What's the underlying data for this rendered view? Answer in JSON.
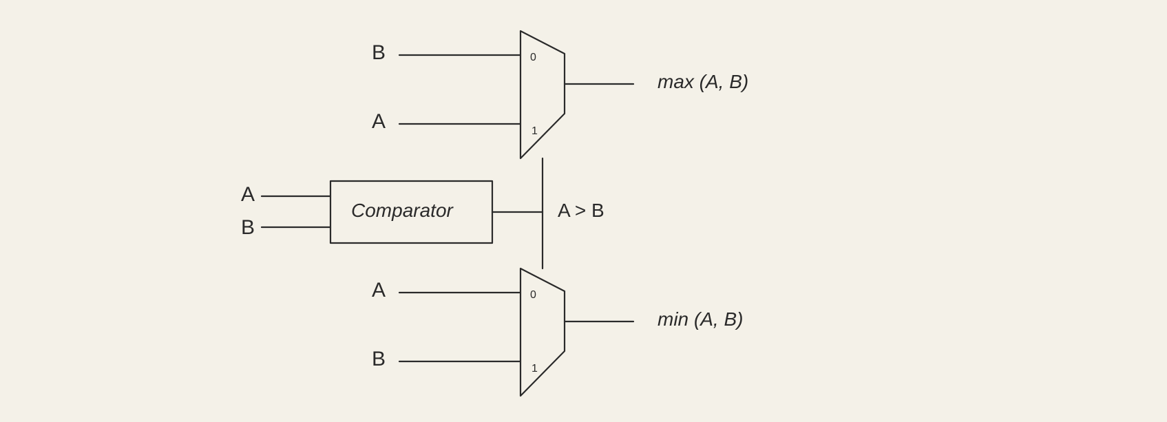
{
  "comparator": {
    "label": "Comparator",
    "inputA": "A",
    "inputB": "B",
    "outputLabel": "A > B"
  },
  "muxTop": {
    "in0": "B",
    "in1": "A",
    "sel0": "0",
    "sel1": "1",
    "out": "max (A, B)"
  },
  "muxBottom": {
    "in0": "A",
    "in1": "B",
    "sel0": "0",
    "sel1": "1",
    "out": "min (A, B)"
  }
}
